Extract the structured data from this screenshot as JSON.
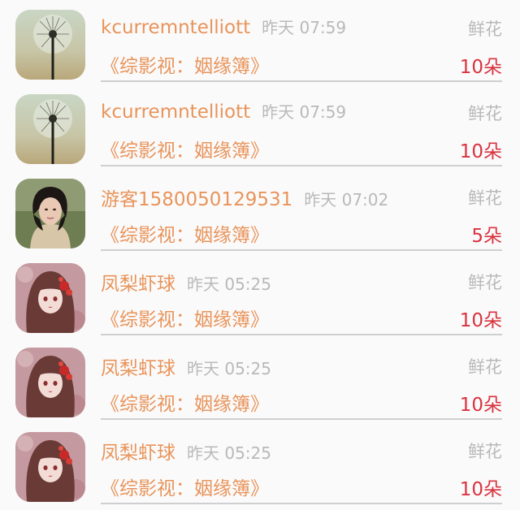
{
  "gifts": [
    {
      "user": "kcurremntelliott",
      "time": "昨天 07:59",
      "gift_type": "鲜花",
      "book": "《综影视：姻缘簿》",
      "amount": "10朵",
      "avatar_icon": "dandelion-avatar"
    },
    {
      "user": "kcurremntelliott",
      "time": "昨天 07:59",
      "gift_type": "鲜花",
      "book": "《综影视：姻缘簿》",
      "amount": "10朵",
      "avatar_icon": "dandelion-avatar"
    },
    {
      "user": "游客1580050129531",
      "time": "昨天 07:02",
      "gift_type": "鲜花",
      "book": "《综影视：姻缘簿》",
      "amount": "5朵",
      "avatar_icon": "woman-photo-avatar"
    },
    {
      "user": "凤梨虾球",
      "time": "昨天 05:25",
      "gift_type": "鲜花",
      "book": "《综影视：姻缘簿》",
      "amount": "10朵",
      "avatar_icon": "anime-girl-avatar"
    },
    {
      "user": "凤梨虾球",
      "time": "昨天 05:25",
      "gift_type": "鲜花",
      "book": "《综影视：姻缘簿》",
      "amount": "10朵",
      "avatar_icon": "anime-girl-avatar"
    },
    {
      "user": "凤梨虾球",
      "time": "昨天 05:25",
      "gift_type": "鲜花",
      "book": "《综影视：姻缘簿》",
      "amount": "10朵",
      "avatar_icon": "anime-girl-avatar"
    }
  ],
  "colors": {
    "username": "#e8945a",
    "timestamp": "#b9b9b9",
    "amount": "#d8333f",
    "divider": "#cfcfcf"
  }
}
